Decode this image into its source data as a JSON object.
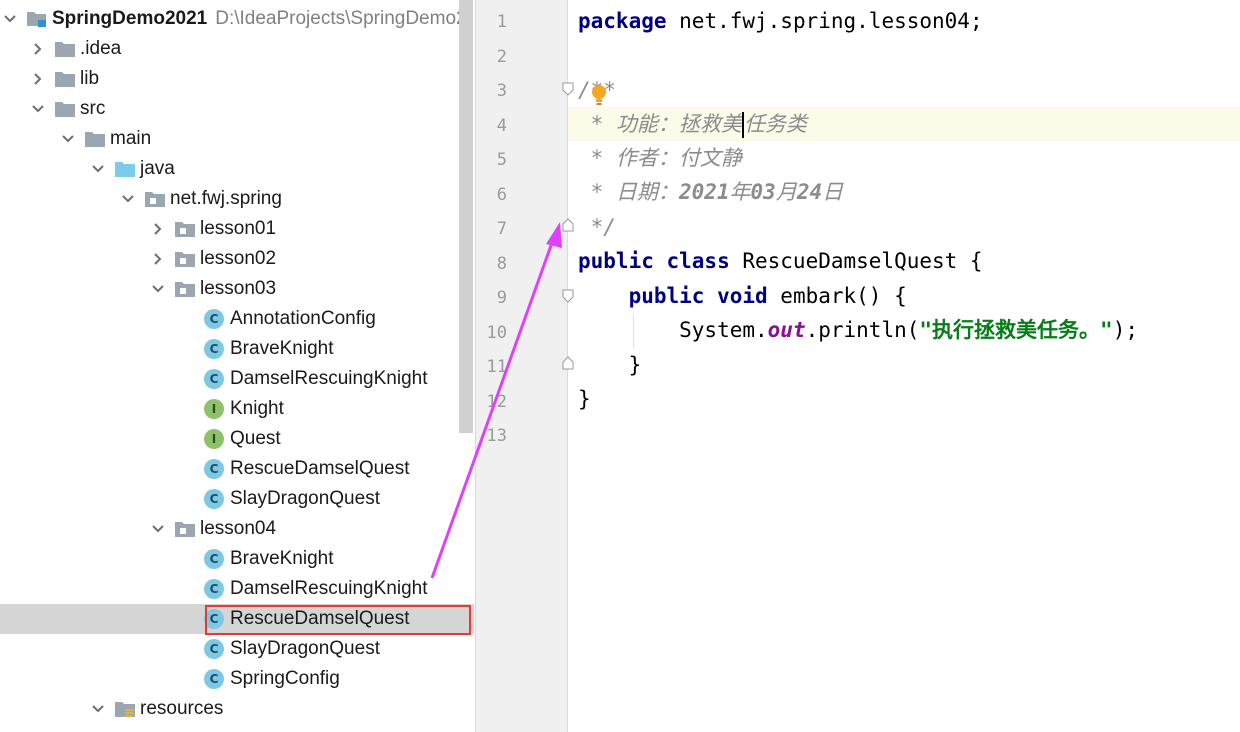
{
  "project": {
    "name": "SpringDemo2021",
    "path": "D:\\IdeaProjects\\SpringDemo2"
  },
  "tree": [
    {
      "label": "SpringDemo2021",
      "depth": 0,
      "icon": "project-folder-icon",
      "chev": "down",
      "bold": true
    },
    {
      "label": ".idea",
      "depth": 1,
      "icon": "folder-icon",
      "chev": "right"
    },
    {
      "label": "lib",
      "depth": 1,
      "icon": "folder-icon",
      "chev": "right"
    },
    {
      "label": "src",
      "depth": 1,
      "icon": "folder-icon",
      "chev": "down"
    },
    {
      "label": "main",
      "depth": 2,
      "icon": "folder-icon",
      "chev": "down"
    },
    {
      "label": "java",
      "depth": 3,
      "icon": "source-folder-icon",
      "chev": "down"
    },
    {
      "label": "net.fwj.spring",
      "depth": 4,
      "icon": "package-icon",
      "chev": "down"
    },
    {
      "label": "lesson01",
      "depth": 5,
      "icon": "package-icon",
      "chev": "right"
    },
    {
      "label": "lesson02",
      "depth": 5,
      "icon": "package-icon",
      "chev": "right"
    },
    {
      "label": "lesson03",
      "depth": 5,
      "icon": "package-icon",
      "chev": "down"
    },
    {
      "label": "AnnotationConfig",
      "depth": 6,
      "icon": "class-icon",
      "chev": "none"
    },
    {
      "label": "BraveKnight",
      "depth": 6,
      "icon": "class-icon",
      "chev": "none"
    },
    {
      "label": "DamselRescuingKnight",
      "depth": 6,
      "icon": "class-icon",
      "chev": "none"
    },
    {
      "label": "Knight",
      "depth": 6,
      "icon": "interface-icon",
      "chev": "none"
    },
    {
      "label": "Quest",
      "depth": 6,
      "icon": "interface-icon",
      "chev": "none"
    },
    {
      "label": "RescueDamselQuest",
      "depth": 6,
      "icon": "class-icon",
      "chev": "none"
    },
    {
      "label": "SlayDragonQuest",
      "depth": 6,
      "icon": "class-icon",
      "chev": "none"
    },
    {
      "label": "lesson04",
      "depth": 5,
      "icon": "package-icon",
      "chev": "down"
    },
    {
      "label": "BraveKnight",
      "depth": 6,
      "icon": "class-icon",
      "chev": "none"
    },
    {
      "label": "DamselRescuingKnight",
      "depth": 6,
      "icon": "class-icon",
      "chev": "none"
    },
    {
      "label": "RescueDamselQuest",
      "depth": 6,
      "icon": "class-icon",
      "chev": "none",
      "selected": true
    },
    {
      "label": "SlayDragonQuest",
      "depth": 6,
      "icon": "class-icon",
      "chev": "none"
    },
    {
      "label": "SpringConfig",
      "depth": 6,
      "icon": "class-icon",
      "chev": "none"
    },
    {
      "label": "resources",
      "depth": 3,
      "icon": "resources-folder-icon",
      "chev": "down"
    }
  ],
  "editor": {
    "line_numbers": [
      "1",
      "2",
      "3",
      "4",
      "5",
      "6",
      "7",
      "8",
      "9",
      "10",
      "11",
      "12",
      "13"
    ],
    "current_line": 4,
    "code": {
      "l1_kw": "package",
      "l1_rest": " net.fwj.spring.lesson04;",
      "l3": "/**",
      "l4_a": " * 功能：拯救美",
      "l4_b": "任务类",
      "l5": " * 作者：付文静",
      "l6_a": " * 日期：",
      "l6_b": "2021",
      "l6_c": "年",
      "l6_d": "03",
      "l6_e": "月",
      "l6_f": "24",
      "l6_g": "日",
      "l7": " */",
      "l8_kw": "public class",
      "l8_rest": " RescueDamselQuest {",
      "l9_kw": "    public void",
      "l9_rest": " embark() {",
      "l10_a": "        System.",
      "l10_field": "out",
      "l10_b": ".println(",
      "l10_str": "\"执行拯救美任务。\"",
      "l10_c": ");",
      "l11": "    }",
      "l12": "}"
    }
  },
  "colors": {
    "keyword": "#000080",
    "comment": "#8c8c8c",
    "string": "#067d17",
    "field": "#871094",
    "highlight_box": "#e53935",
    "arrow": "#e040fb",
    "selection": "#d5d5d5"
  }
}
